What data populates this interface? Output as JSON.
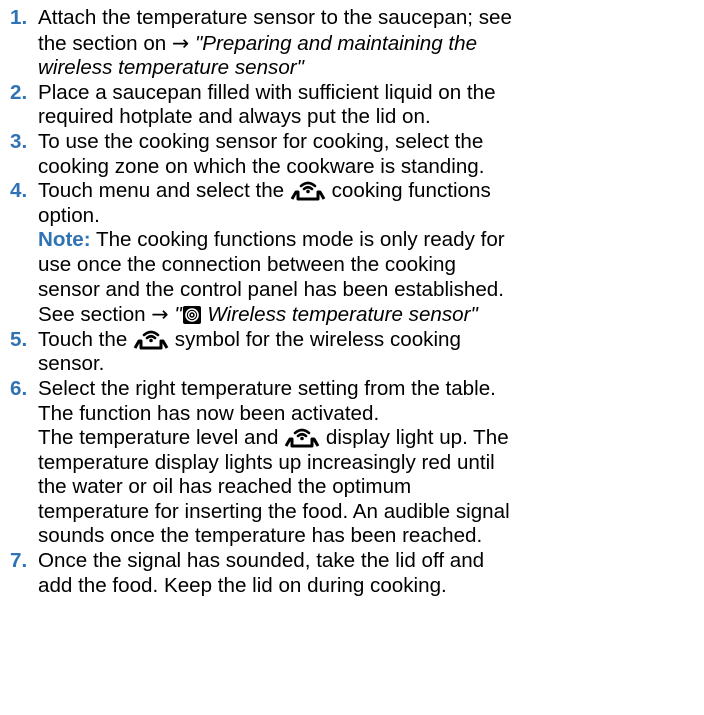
{
  "steps": [
    {
      "num": "1.",
      "lines": [
        "Attach the temperature sensor to the saucepan; see",
        "the section on",
        "\"Preparing and maintaining the",
        "wireless temperature sensor\""
      ]
    },
    {
      "num": "2.",
      "lines": [
        "Place a saucepan filled with sufficient liquid on the",
        "required hotplate and always put the lid on."
      ]
    },
    {
      "num": "3.",
      "lines": [
        "To use the cooking sensor for cooking, select the",
        "cooking zone on which the cookware is standing."
      ]
    },
    {
      "num": "4.",
      "lines": [
        "Touch menu and select the",
        "cooking functions",
        "option."
      ],
      "note": {
        "label": "Note:",
        "lines": [
          "The cooking functions mode is only ready for",
          "use once the connection between the cooking",
          "sensor and the control panel has been established.",
          "See section",
          "\"",
          "Wireless temperature sensor\""
        ]
      }
    },
    {
      "num": "5.",
      "lines": [
        "Touch the",
        "symbol for the wireless cooking",
        "sensor."
      ]
    },
    {
      "num": "6.",
      "lines": [
        "Select the right temperature setting from the table.",
        "The function has now been activated.",
        "The temperature level and",
        "display light up. The",
        "temperature display lights up increasingly red until",
        "the water or oil has reached the optimum",
        "temperature for inserting the food. An audible signal",
        "sounds once the temperature has been reached."
      ]
    },
    {
      "num": "7.",
      "lines": [
        "Once the signal has sounded, take the lid off and",
        "add the food. Keep the lid on during cooking."
      ]
    }
  ],
  "icons": {
    "arrow": "→",
    "sensor_icon": "wireless-cooking-sensor-icon",
    "wireless_icon": "wireless-temperature-sensor-icon"
  },
  "colors": {
    "accent": "#2f73b5",
    "text": "#000000"
  }
}
